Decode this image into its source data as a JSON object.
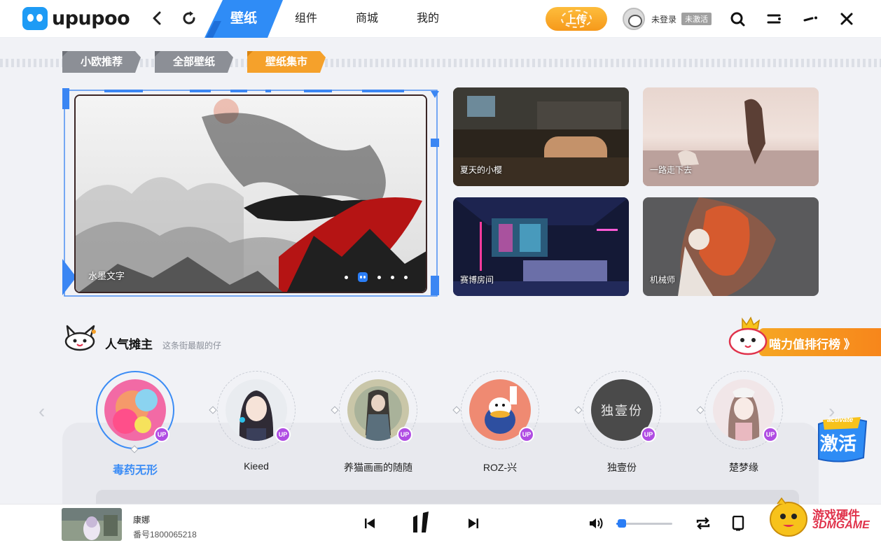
{
  "app": {
    "logo_text": "upupoo"
  },
  "nav": {
    "tabs": [
      {
        "label": "壁纸",
        "active": true
      },
      {
        "label": "组件"
      },
      {
        "label": "商城"
      },
      {
        "label": "我的"
      }
    ],
    "upload_label": "上传",
    "user_status": "未登录",
    "activation_badge": "未激活"
  },
  "subtabs": [
    {
      "label": "小欧推荐",
      "color": "#8c8f96"
    },
    {
      "label": "全部壁纸",
      "color": "#8c8f96"
    },
    {
      "label": "壁纸集市",
      "color": "#f5a12b"
    }
  ],
  "banner": {
    "caption": "水墨文字",
    "dots": 5,
    "active_dot": 2
  },
  "cards": [
    {
      "caption": "夏天的小樱"
    },
    {
      "caption": "一路走下去"
    },
    {
      "caption": "赛博房间"
    },
    {
      "caption": "机械师"
    }
  ],
  "section": {
    "title": "人气摊主",
    "subtitle": "这条街最靓的仔",
    "rank_label": "喵力值排行榜 》"
  },
  "creators": [
    {
      "name": "毒药无形",
      "badge": "UP",
      "active": true
    },
    {
      "name": "Kieed",
      "badge": "UP"
    },
    {
      "name": "养猫画画的随随",
      "badge": "UP"
    },
    {
      "name": "ROZ-兴",
      "badge": "UP"
    },
    {
      "name": "独壹份",
      "badge": "UP",
      "avatar_text": "独壹份"
    },
    {
      "name": "楚梦缘",
      "badge": "UP"
    }
  ],
  "activate_label": "激活",
  "activate_sub": "activate",
  "player": {
    "title": "康娜",
    "id_text": "番号1800065218",
    "volume": 0.1
  },
  "watermark": {
    "line1": "游戏硬件",
    "line2": "3DMGAME"
  },
  "colors": {
    "accent": "#2a7df5",
    "orange": "#f5a12b",
    "up_badge": "#b04de3"
  }
}
